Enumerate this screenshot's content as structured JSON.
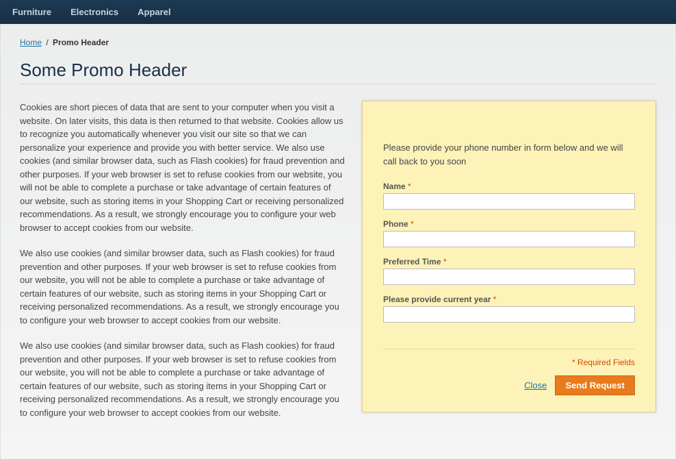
{
  "nav": {
    "items": [
      {
        "label": "Furniture"
      },
      {
        "label": "Electronics"
      },
      {
        "label": "Apparel"
      }
    ]
  },
  "breadcrumb": {
    "home": "Home",
    "sep": "/",
    "current": "Promo Header"
  },
  "page": {
    "title": "Some Promo Header"
  },
  "body": {
    "p1": "Cookies are short pieces of data that are sent to your computer when you visit a website. On later visits, this data is then returned to that website. Cookies allow us to recognize you automatically whenever you visit our site so that we can personalize your experience and provide you with better service. We also use cookies (and similar browser data, such as Flash cookies) for fraud prevention and other purposes. If your web browser is set to refuse cookies from our website, you will not be able to complete a purchase or take advantage of certain features of our website, such as storing items in your Shopping Cart or receiving personalized recommendations. As a result, we strongly encourage you to configure your web browser to accept cookies from our website.",
    "p2": "We also use cookies (and similar browser data, such as Flash cookies) for fraud prevention and other purposes. If your web browser is set to refuse cookies from our website, you will not be able to complete a purchase or take advantage of certain features of our website, such as storing items in your Shopping Cart or receiving personalized recommendations. As a result, we strongly encourage you to configure your web browser to accept cookies from our website.",
    "p3": "We also use cookies (and similar browser data, such as Flash cookies) for fraud prevention and other purposes. If your web browser is set to refuse cookies from our website, you will not be able to complete a purchase or take advantage of certain features of our website, such as storing items in your Shopping Cart or receiving personalized recommendations. As a result, we strongly encourage you to configure your web browser to accept cookies from our website."
  },
  "form": {
    "intro": "Please provide your phone number in form below and we will call back to you soon",
    "fields": {
      "name": {
        "label": "Name",
        "required": "*"
      },
      "phone": {
        "label": "Phone",
        "required": "*"
      },
      "preferred_time": {
        "label": "Preferred Time",
        "required": "*"
      },
      "year": {
        "label": "Please provide current year",
        "required": "*"
      }
    },
    "required_note": "* Required Fields",
    "close": "Close",
    "submit": "Send Request"
  }
}
